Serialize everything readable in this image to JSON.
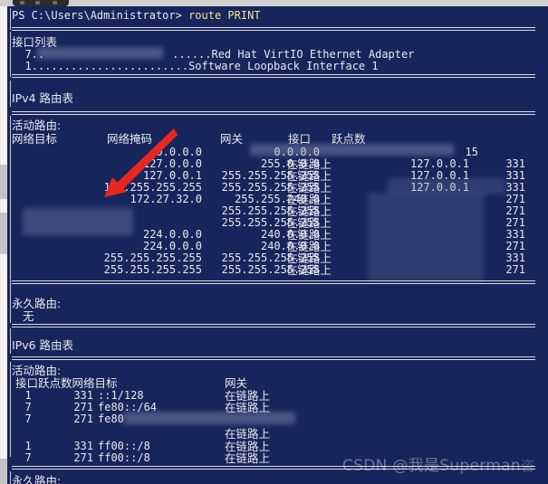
{
  "window": {
    "title_fragment": "",
    "shell": "PowerShell"
  },
  "prompt": {
    "text": "PS C:\\Users\\Administrator> ",
    "command": "route PRINT"
  },
  "sections": {
    "interface_list_title": "接口列表",
    "ipv4_title": "IPv4 路由表",
    "ipv6_title": "IPv6 路由表",
    "active_routes": "活动路由:",
    "persistent_routes": "永久路由:",
    "persistent_none": "无"
  },
  "interfaces": [
    {
      "index": "  7..",
      "dots": "",
      "redacted": true,
      "tail": "......Red Hat VirtIO Ethernet Adapter"
    },
    {
      "index": "  1",
      "dots": "........................",
      "redacted": false,
      "tail": "Software Loopback Interface 1"
    }
  ],
  "ipv4": {
    "headers": {
      "destination": "网络目标",
      "netmask": "网络掩码",
      "gateway": "网关",
      "interface": "接口",
      "metric": "跃点数"
    },
    "on_link": "在链路上",
    "rows": [
      {
        "destination": "0.0.0.0",
        "netmask": "0.0.0.0",
        "gateway": "",
        "interface": "",
        "metric": "15"
      },
      {
        "destination": "127.0.0.0",
        "netmask": "255.0.0.0",
        "gateway": "在链路上",
        "interface": "127.0.0.1",
        "metric": "331"
      },
      {
        "destination": "127.0.0.1",
        "netmask": "255.255.255.255",
        "gateway": "在链路上",
        "interface": "127.0.0.1",
        "metric": "331"
      },
      {
        "destination": "127.255.255.255",
        "netmask": "255.255.255.255",
        "gateway": "在链路上",
        "interface": "127.0.0.1",
        "metric": "331"
      },
      {
        "destination": "172.27.32.0",
        "netmask": "255.255.240.0",
        "gateway": "在链路上",
        "interface": "",
        "metric": "271"
      },
      {
        "destination": "",
        "netmask": "255.255.255.255",
        "gateway": "在链路上",
        "interface": "",
        "metric": "271"
      },
      {
        "destination": "",
        "netmask": "255.255.255.255",
        "gateway": "在链路上",
        "interface": "",
        "metric": "271"
      },
      {
        "destination": "224.0.0.0",
        "netmask": "240.0.0.0",
        "gateway": "在链路上",
        "interface": "",
        "metric": "331"
      },
      {
        "destination": "224.0.0.0",
        "netmask": "240.0.0.0",
        "gateway": "在链路上",
        "interface": "",
        "metric": "271"
      },
      {
        "destination": "255.255.255.255",
        "netmask": "255.255.255.255",
        "gateway": "在链路上",
        "interface": "",
        "metric": "331"
      },
      {
        "destination": "255.255.255.255",
        "netmask": "255.255.255.255",
        "gateway": "在链路上",
        "interface": "",
        "metric": "271"
      }
    ]
  },
  "ipv6": {
    "headers": {
      "if_metric_dest": "接口跃点数网络目标",
      "gateway": "网关"
    },
    "rows": [
      {
        "if": "  1",
        "metric": "331",
        "destination": "::1/128",
        "gateway": "在链路上",
        "redacted": false
      },
      {
        "if": "  7",
        "metric": "271",
        "destination": "fe80::/64",
        "gateway": "在链路上",
        "redacted": false
      },
      {
        "if": "  7",
        "metric": "271",
        "destination": "fe80",
        "gateway": "在链路上",
        "redacted": true
      },
      {
        "if": "  1",
        "metric": "331",
        "destination": "ff00::/8",
        "gateway": "在链路上",
        "redacted": false
      },
      {
        "if": "  7",
        "metric": "271",
        "destination": "ff00::/8",
        "gateway": "在链路上",
        "redacted": false
      }
    ]
  },
  "annotation": {
    "arrow_color": "#e8271f",
    "points_to": "127.255.255.255"
  },
  "watermark": {
    "text": "CSDN @我是Superman",
    "tail": "咨"
  },
  "colors": {
    "terminal_background": "#16255c",
    "terminal_text": "#e9e9ec",
    "command_text": "#f3e58b",
    "rule": "#dcdce4",
    "scrollbar": "#eaeaea"
  }
}
